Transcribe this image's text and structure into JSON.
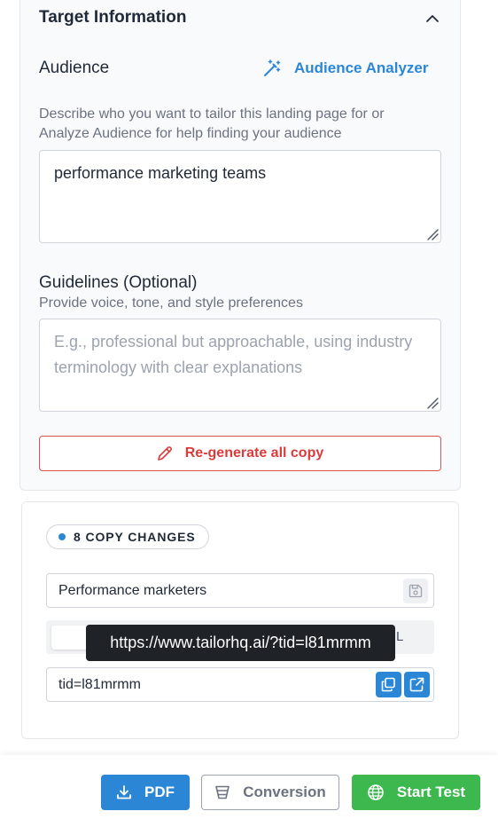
{
  "target_info": {
    "title": "Target Information",
    "audience_label": "Audience",
    "analyzer_button": "Audience Analyzer",
    "audience_help_line1": "Describe who you want to tailor this landing page for or",
    "audience_help_line2": "Analyze Audience for help finding your audience",
    "audience_value": "performance marketing teams",
    "guidelines_label": "Guidelines (Optional)",
    "guidelines_help": "Provide voice, tone, and style preferences",
    "guidelines_placeholder": "E.g., professional but approachable, using industry terminology with clear explanations",
    "regenerate_button": "Re-generate all copy"
  },
  "changes": {
    "badge": "8 COPY CHANGES",
    "name_value": "Performance marketers",
    "toggle_tail": "L",
    "tooltip": "https://www.tailorhq.ai/?tid=l81mrmm",
    "tid_value": "tid=l81mrmm"
  },
  "footer": {
    "pdf": "PDF",
    "conversion": "Conversion",
    "start_test": "Start Test"
  },
  "colors": {
    "accent": "#2b87d6",
    "danger": "#dc3b3b",
    "success": "#3cb84f"
  }
}
